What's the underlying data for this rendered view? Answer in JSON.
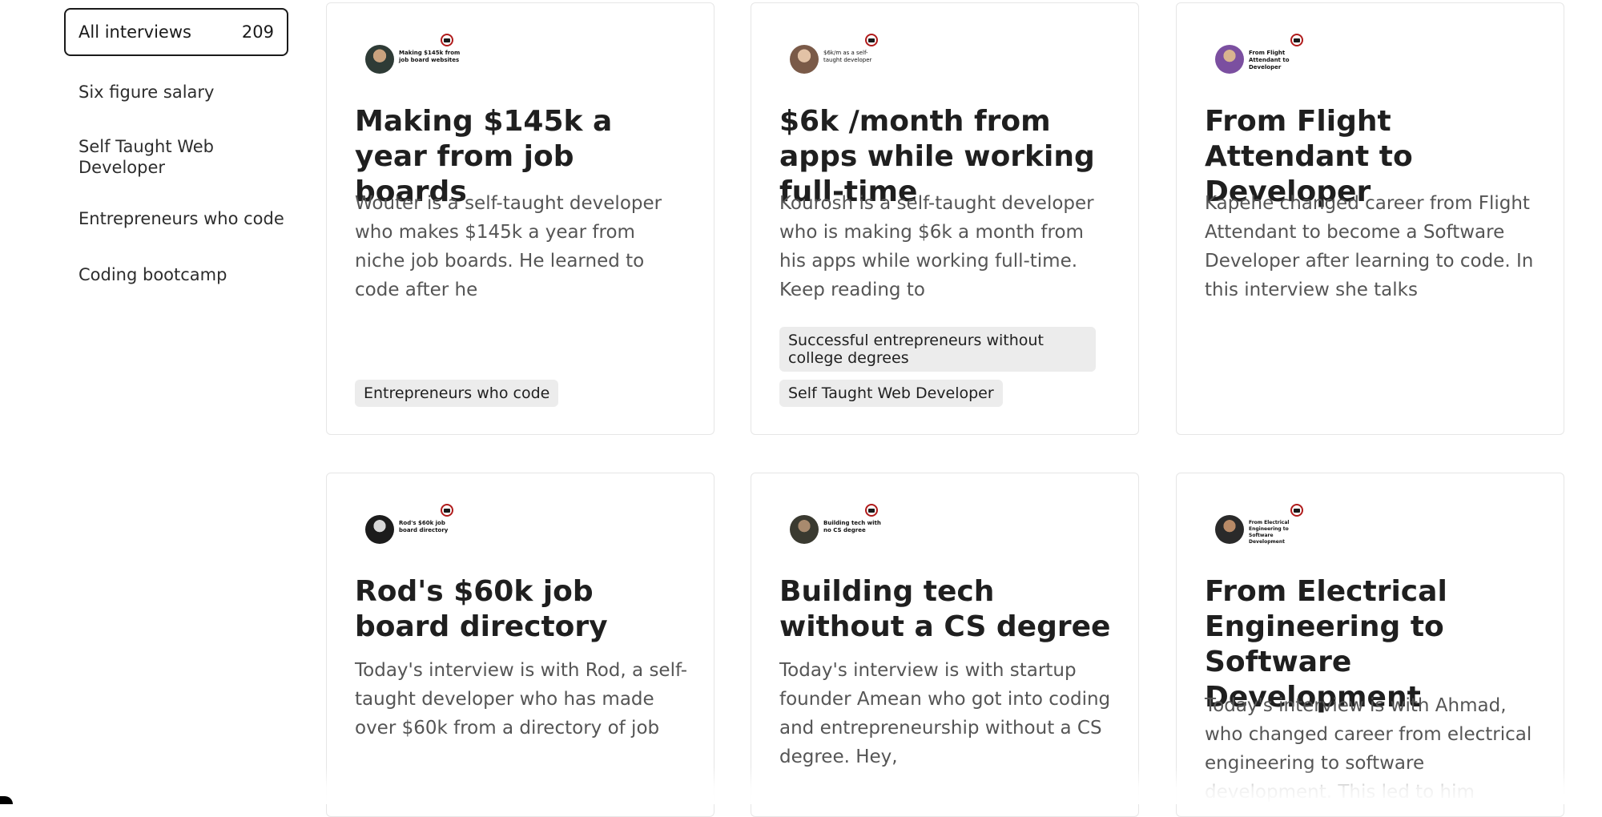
{
  "sidebar": {
    "all_label": "All interviews",
    "all_count": "209",
    "items": [
      {
        "label": "Six figure salary"
      },
      {
        "label": "Self Taught Web Developer"
      },
      {
        "label": "Entrepreneurs who code"
      },
      {
        "label": "Coding bootcamp"
      }
    ]
  },
  "cards": [
    {
      "thumb_text": "Making $145k from job board websites",
      "title": "Making $145k a year from job boards",
      "excerpt": "Wouter is a self-taught developer who makes $145k a year from niche job boards. He learned to code after he",
      "tags": [
        "Entrepreneurs who code"
      ]
    },
    {
      "thumb_text": "$6k/m as a self-taught developer",
      "title": "$6k /month from apps while working full-time",
      "excerpt": "Kourosh is a self-taught developer who is making $6k a month from his apps while working full-time. Keep reading to",
      "tags": [
        "Successful entrepreneurs without college degrees",
        "Self Taught Web Developer"
      ]
    },
    {
      "thumb_text": "From Flight Attendant to Developer",
      "title": "From Flight Attendant to Developer",
      "excerpt": "Kapehe changed career from Flight Attendant to become a Software Developer after learning to code. In this interview she talks",
      "tags": []
    },
    {
      "thumb_text": "Rod's $60k job board directory",
      "title": "Rod's $60k job board directory",
      "excerpt": "Today's interview is with Rod, a self-taught developer who has made over $60k from a directory of job",
      "tags": []
    },
    {
      "thumb_text": "Building tech with no CS degree",
      "title": "Building tech without a CS degree",
      "excerpt": "Today's interview is with startup founder Amean who got into coding and entrepreneurship without a CS degree. Hey,",
      "tags": []
    },
    {
      "thumb_text": "From Electrical Engineering to Software Development",
      "title": "From Electrical Engineering to Software Development",
      "excerpt": "Today's interview is with Ahmad, who changed career from electrical engineering to software development. This led to him",
      "tags": []
    }
  ],
  "icons": {
    "thumbnail_seal": "graduation-cap-seal-icon",
    "thumbnail_avatar": "avatar"
  },
  "colors": {
    "text": "#1f1f1f",
    "muted": "#555555",
    "tag_bg": "#ececec",
    "card_border": "#e6e6e6",
    "seal_red": "#b01b1b"
  }
}
